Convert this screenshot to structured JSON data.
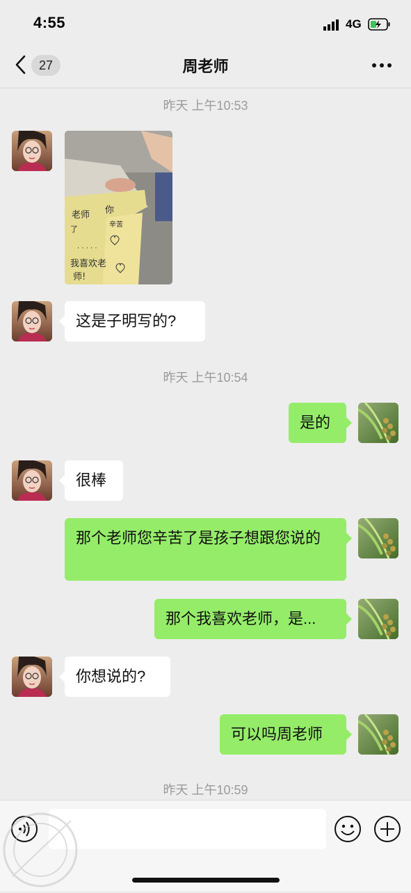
{
  "status_bar": {
    "time": "4:55",
    "network": "4G"
  },
  "nav": {
    "back_count": "27",
    "title": "周老师"
  },
  "messages": [
    {
      "type": "timestamp",
      "text": "昨天 上午10:53"
    },
    {
      "type": "image",
      "side": "left",
      "handwriting": [
        "老师",
        "你",
        "了",
        "辛苦",
        "我",
        "我喜欢老",
        "师!"
      ]
    },
    {
      "type": "text",
      "side": "left",
      "text": "这是子明写的?"
    },
    {
      "type": "timestamp",
      "text": "昨天 上午10:54"
    },
    {
      "type": "text",
      "side": "right",
      "text": "是的"
    },
    {
      "type": "text",
      "side": "left",
      "text": "很棒"
    },
    {
      "type": "text",
      "side": "right",
      "text": "那个老师您辛苦了是孩子想跟您说的"
    },
    {
      "type": "text",
      "side": "right",
      "text": "那个我喜欢老师，是..."
    },
    {
      "type": "text",
      "side": "left",
      "text": "你想说的?"
    },
    {
      "type": "text",
      "side": "right",
      "text": "可以吗周老师"
    },
    {
      "type": "timestamp",
      "text": "昨天 上午10:59"
    }
  ],
  "input_bar": {
    "placeholder": "",
    "voice_icon": "voice-icon",
    "emoji_icon": "emoji-icon",
    "plus_icon": "plus-icon"
  },
  "colors": {
    "background": "#ededed",
    "outgoing_bubble": "#95ec69",
    "incoming_bubble": "#ffffff",
    "timestamp": "#9b9b9b"
  }
}
